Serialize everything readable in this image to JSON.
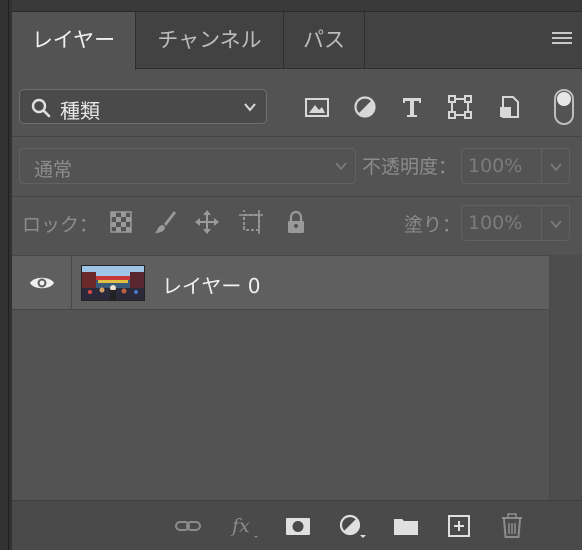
{
  "tabs": [
    {
      "label": "レイヤー",
      "active": true
    },
    {
      "label": "チャンネル",
      "active": false
    },
    {
      "label": "パス",
      "active": false
    }
  ],
  "filter": {
    "kind_label": "種類",
    "filter_icons": [
      "image-filter-icon",
      "adjustment-filter-icon",
      "type-filter-icon",
      "shape-filter-icon",
      "smart-object-filter-icon"
    ],
    "toggle_on": true
  },
  "blend": {
    "mode": "通常",
    "opacity_label": "不透明度：",
    "opacity_value": "100%"
  },
  "lock": {
    "label": "ロック：",
    "icons": [
      "lock-transparent-pixels-icon",
      "lock-image-pixels-icon",
      "lock-position-icon",
      "lock-artboard-icon",
      "lock-all-icon"
    ],
    "fill_label": "塗り：",
    "fill_value": "100%"
  },
  "layers": [
    {
      "name": "レイヤー 0",
      "visible": true
    }
  ],
  "footer_icons": [
    "link-layers-icon",
    "layer-style-fx-icon",
    "add-mask-icon",
    "new-adjustment-layer-icon",
    "new-group-folder-icon",
    "new-layer-icon",
    "delete-layer-icon"
  ],
  "colors": {
    "panel_bg": "#535353",
    "tabbar_bg": "#424242",
    "selected_row": "#5f5f5f",
    "text_primary": "#f0f0f0",
    "text_disabled": "#8c8c8c"
  }
}
